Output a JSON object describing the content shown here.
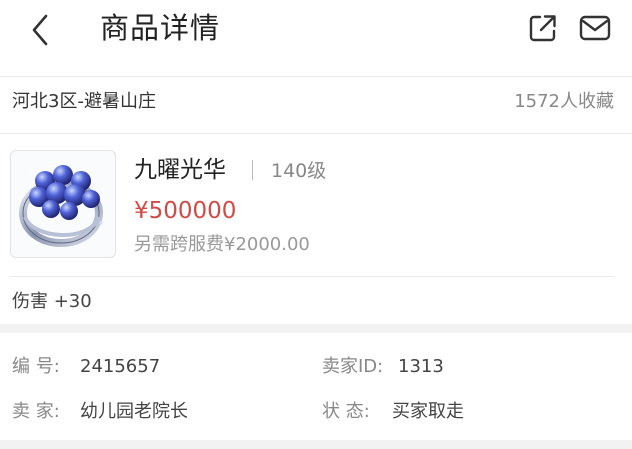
{
  "header": {
    "title": "商品详情",
    "back_icon": "chevron-left-icon",
    "share_icon": "share-icon",
    "message_icon": "mail-icon"
  },
  "summary": {
    "server": "河北3区-避暑山庄",
    "favorites": "1572人收藏"
  },
  "item": {
    "image_icon": "ring-with-blue-gems-icon",
    "name": "九曜光华",
    "level": "140级",
    "price": "¥500000",
    "cross_server_fee": "另需跨服费¥2000.00",
    "attribute": "伤害 +30",
    "price_color": "#d24a45"
  },
  "info": {
    "id_label": "编  号:",
    "id_value": "2415657",
    "seller_id_label": "卖家ID:",
    "seller_id_value": "1313",
    "seller_label": "卖  家:",
    "seller_value": "幼儿园老院长",
    "status_label": "状  态:",
    "status_value": "买家取走"
  }
}
